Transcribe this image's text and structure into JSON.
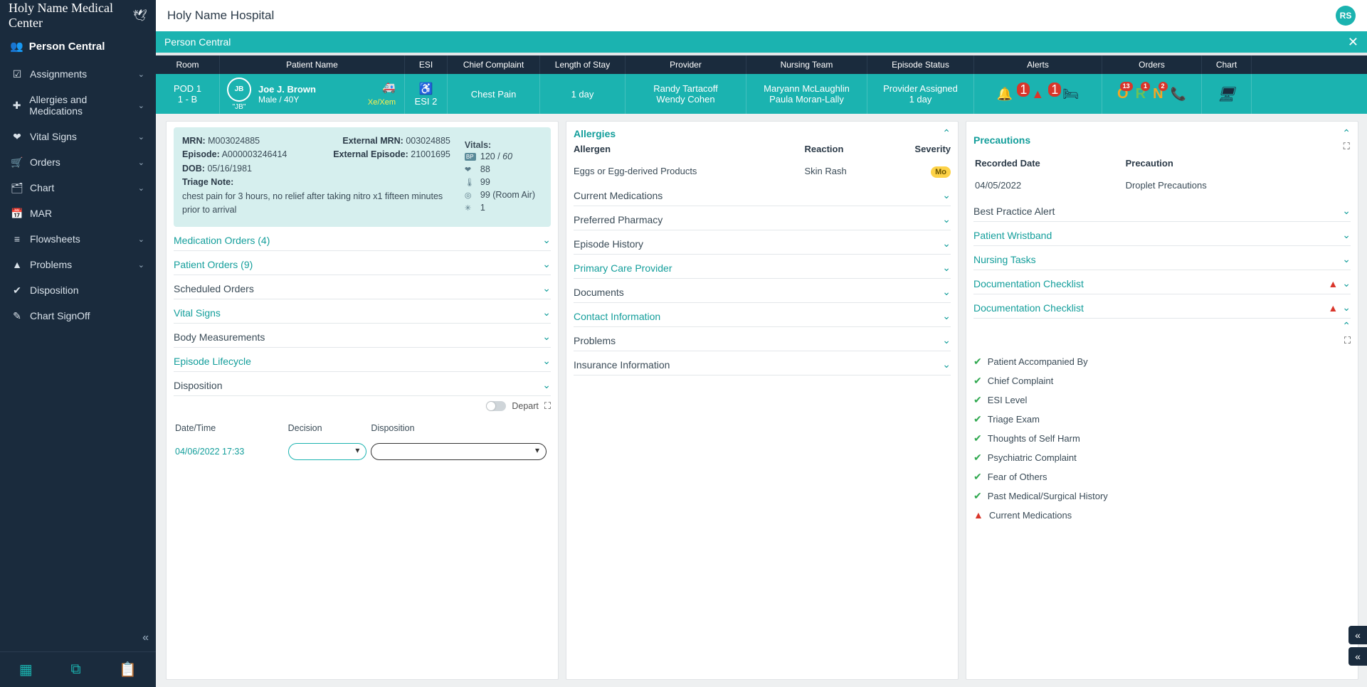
{
  "logo": "Holy Name Medical Center",
  "sidebar_title": "Person Central",
  "nav": [
    {
      "icon": "☑",
      "label": "Assignments",
      "chev": true
    },
    {
      "icon": "✚",
      "label": "Allergies and Medications",
      "chev": true
    },
    {
      "icon": "❤",
      "label": "Vital Signs",
      "chev": true
    },
    {
      "icon": "🛒",
      "label": "Orders",
      "chev": true
    },
    {
      "icon": "🗂",
      "label": "Chart",
      "chev": true
    },
    {
      "icon": "📅",
      "label": "MAR",
      "chev": false
    },
    {
      "icon": "≡",
      "label": "Flowsheets",
      "chev": true
    },
    {
      "icon": "▲",
      "label": "Problems",
      "chev": true
    },
    {
      "icon": "✔",
      "label": "Disposition",
      "chev": false
    },
    {
      "icon": "✎",
      "label": "Chart SignOff",
      "chev": false
    }
  ],
  "topbar": {
    "title": "Holy Name Hospital",
    "user_initials": "RS"
  },
  "person_bar": "Person Central",
  "headers": [
    "Room",
    "Patient Name",
    "ESI",
    "Chief Complaint",
    "Length of Stay",
    "Provider",
    "Nursing Team",
    "Episode Status",
    "Alerts",
    "Orders",
    "Chart"
  ],
  "patient": {
    "room_line1": "POD 1",
    "room_line2": "1 - B",
    "initials": "JB",
    "jb_quote": "\"JB\"",
    "name": "Joe J. Brown",
    "demo": "Male / 40Y",
    "pronoun": "Xe/Xem",
    "esi": "ESI 2",
    "cc": "Chest Pain",
    "los": "1 day",
    "providers": [
      "Randy Tartacoff",
      "Wendy Cohen"
    ],
    "nurses": [
      "Maryann McLaughlin",
      "Paula Moran-Lally"
    ],
    "status_line1": "Provider Assigned",
    "status_line2": "1 day",
    "alert_badges": {
      "bell": "1",
      "tri": "1"
    },
    "orders_badges": {
      "O": "13",
      "R": "1",
      "N": "2"
    }
  },
  "info": {
    "mrn_label": "MRN:",
    "mrn": "M003024885",
    "ext_mrn_label": "External MRN:",
    "ext_mrn": "003024885",
    "episode_label": "Episode:",
    "episode": "A000003246414",
    "ext_ep_label": "External Episode:",
    "ext_ep": "21001695",
    "dob_label": "DOB:",
    "dob": "05/16/1981",
    "triage_label": "Triage Note:",
    "triage": "chest pain for 3 hours, no relief after taking nitro x1  fifteen minutes prior to arrival"
  },
  "vitals": {
    "title": "Vitals:",
    "bp": "120 / 60",
    "bp_sys": "120",
    "bp_dia_pref": " / ",
    "bp_dia": "60",
    "hr": "88",
    "temp": "99",
    "spo2": "99 (Room Air)",
    "pain": "1"
  },
  "left_sections": [
    {
      "title": "Medication Orders  (4)",
      "teal": true
    },
    {
      "title": "Patient Orders  (9)",
      "teal": true
    },
    {
      "title": "Scheduled Orders",
      "teal": false
    },
    {
      "title": "Vital Signs",
      "teal": true
    },
    {
      "title": "Body Measurements",
      "teal": false
    },
    {
      "title": "Episode Lifecycle",
      "teal": true
    }
  ],
  "dispo": {
    "title": "Disposition",
    "depart_label": "Depart",
    "th": [
      "Date/Time",
      "Decision",
      "Disposition"
    ],
    "datetime": "04/06/2022 17:33"
  },
  "mid": {
    "allergies_title": "Allergies",
    "allergy_th": [
      "Allergen",
      "Reaction",
      "Severity"
    ],
    "allergy_rows": [
      {
        "a": "Eggs or Egg-derived Products",
        "r": "Skin Rash",
        "s": "Mo"
      }
    ],
    "sections": [
      {
        "title": "Current Medications",
        "teal": false
      },
      {
        "title": "Preferred Pharmacy",
        "teal": false
      },
      {
        "title": "Episode History",
        "teal": false
      },
      {
        "title": "Primary Care Provider",
        "teal": true
      },
      {
        "title": "Documents",
        "teal": false
      },
      {
        "title": "Contact Information",
        "teal": true
      },
      {
        "title": "Problems",
        "teal": false
      },
      {
        "title": "Insurance Information",
        "teal": false
      }
    ]
  },
  "right": {
    "precautions_title": "Precautions",
    "prec_th": [
      "Recorded Date",
      "Precaution"
    ],
    "prec_rows": [
      {
        "d": "04/05/2022",
        "p": "Droplet Precautions"
      }
    ],
    "sections": [
      {
        "title": "Best Practice Alert",
        "teal": false,
        "warn": false
      },
      {
        "title": "Patient Wristband",
        "teal": true,
        "warn": false
      },
      {
        "title": "Nursing Tasks",
        "teal": true,
        "warn": false
      },
      {
        "title": "Documentation Checklist",
        "teal": true,
        "warn": true
      },
      {
        "title": "Documentation Checklist",
        "teal": true,
        "warn": true
      }
    ],
    "checklist": [
      {
        "ok": true,
        "t": "Patient Accompanied By"
      },
      {
        "ok": true,
        "t": "Chief Complaint"
      },
      {
        "ok": true,
        "t": "ESI Level"
      },
      {
        "ok": true,
        "t": "Triage Exam"
      },
      {
        "ok": true,
        "t": "Thoughts of Self Harm"
      },
      {
        "ok": true,
        "t": "Psychiatric Complaint"
      },
      {
        "ok": true,
        "t": "Fear of Others"
      },
      {
        "ok": true,
        "t": "Past Medical/Surgical History"
      },
      {
        "ok": false,
        "t": "Current Medications"
      }
    ]
  }
}
